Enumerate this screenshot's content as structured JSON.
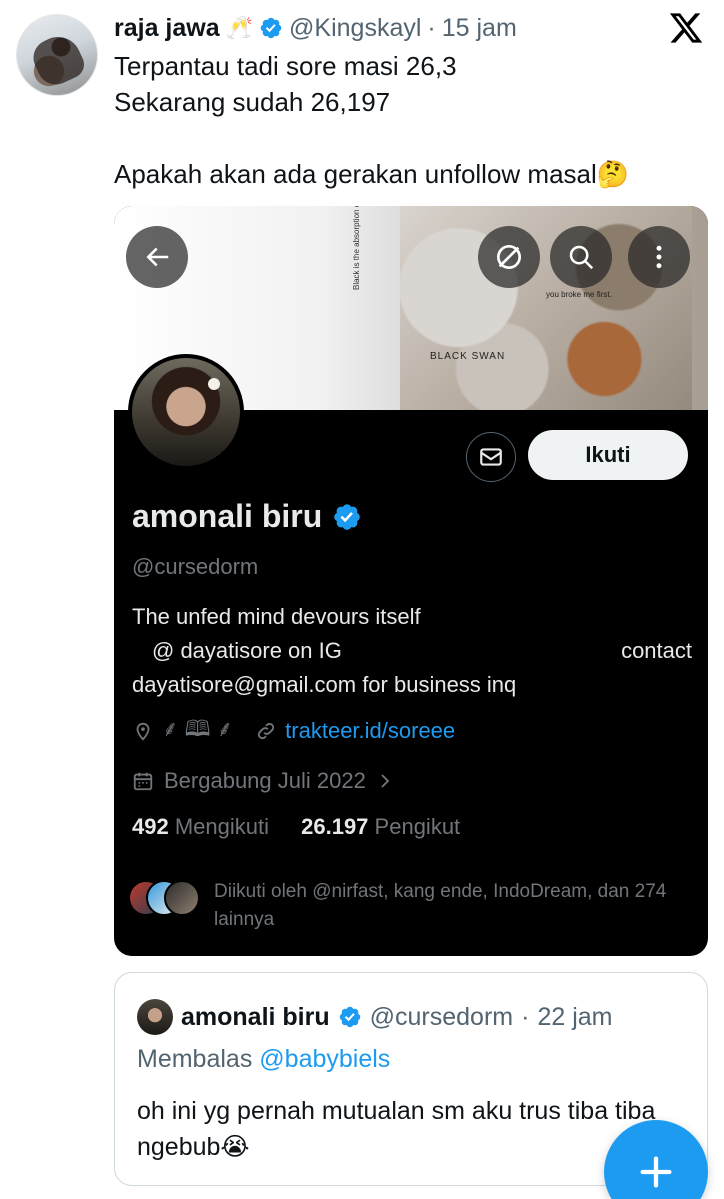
{
  "tweet": {
    "author_name": "raja jawa",
    "author_emoji": "🥂",
    "handle": "@Kingskayl",
    "separator": "·",
    "time": "15 jam",
    "lines": [
      "Terpantau tadi sore masi 26,3",
      "Sekarang sudah 26,197"
    ],
    "line3": "Apakah akan ada gerakan unfollow masal🤔"
  },
  "profile": {
    "name": "amonali biru",
    "handle": "@cursedorm",
    "follow_label": "Ikuti",
    "bio_line1": "The unfed mind devours itself",
    "bio_line2_left": "@ dayatisore on IG",
    "bio_line2_right": "contact",
    "bio_line3": "dayatisore@gmail.com for business inq",
    "location": "⸙ 🕮 ⸙",
    "link": "trakteer.id/soreee",
    "joined": "Bergabung Juli 2022",
    "following_count": "492",
    "following_label": "Mengikuti",
    "followers_count": "26.197",
    "followers_label": "Pengikut",
    "followed_by": "Diikuti oleh @nirfast, kang ende, IndoDream, dan 274 lainnya",
    "banner_caption_vertical": "Black is the absorption of all color",
    "banner_caption_swan": "BLACK SWAN",
    "banner_caption_broke": "you broke me first."
  },
  "quote": {
    "name": "amonali biru",
    "handle": "@cursedorm",
    "separator": "·",
    "time": "22 jam",
    "reply_prefix": "Membalas",
    "reply_to": "@babybiels",
    "text": "oh ini yg pernah mutualan sm aku trus tiba tiba ngebub😭"
  },
  "colors": {
    "accent": "#1d9bf0",
    "text_primary": "#0f1419",
    "text_secondary": "#536471"
  }
}
